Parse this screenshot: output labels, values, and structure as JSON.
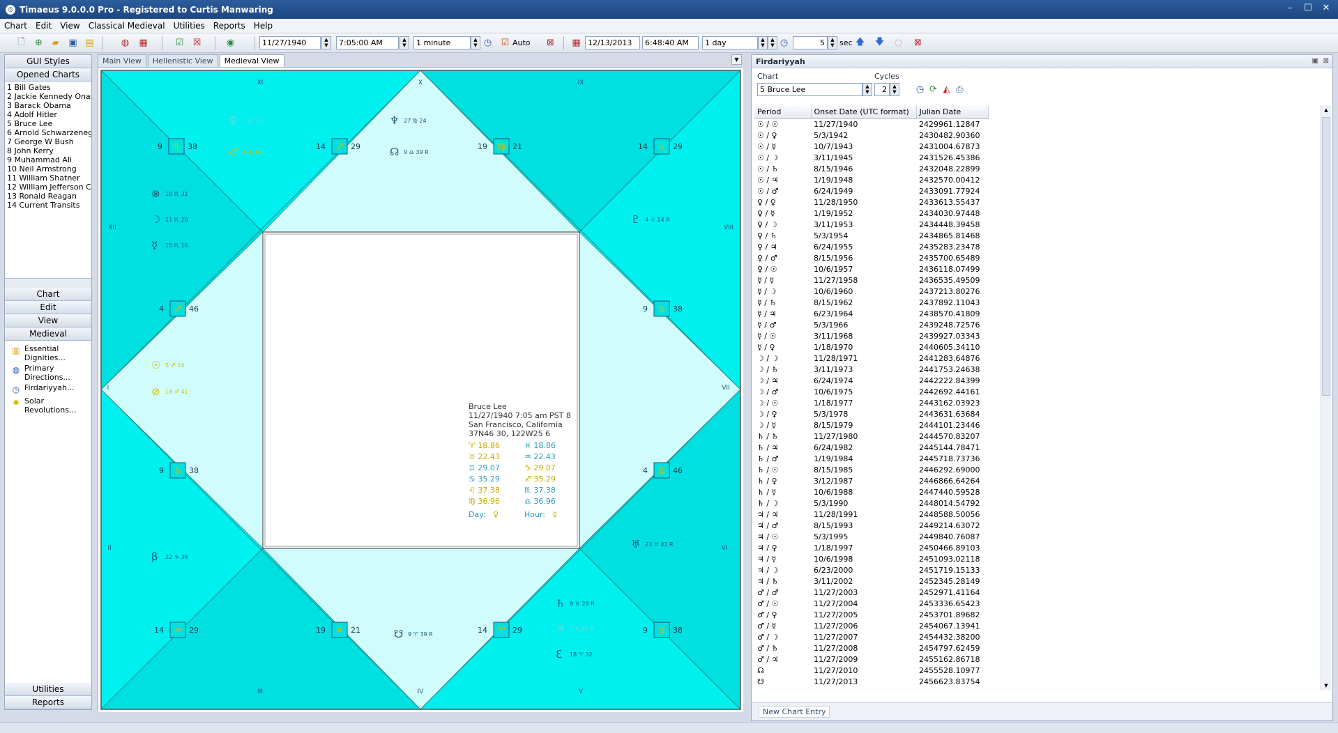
{
  "window": {
    "title": "Timaeus 9.0.0.0 Pro - Registered to Curtis Manwaring",
    "controls": [
      "–",
      "☐",
      "✕"
    ]
  },
  "menu": [
    "Chart",
    "Edit",
    "View",
    "Classical Medieval",
    "Utilities",
    "Reports",
    "Help"
  ],
  "toolbar": {
    "birth_date": "11/27/1940",
    "birth_time": "7:05:00 AM",
    "step1": "1 minute",
    "auto_label": "Auto",
    "transit_date": "12/13/2013",
    "transit_time": "6:48:40 AM",
    "step2": "1 day",
    "seconds": "5",
    "sec_label": "sec"
  },
  "left": {
    "gui_styles": "GUI Styles",
    "opened_charts": "Opened Charts",
    "charts": [
      "1 Bill Gates",
      "2 Jackie Kennedy Onassis",
      "3 Barack Obama",
      "4 Adolf Hitler",
      "5 Bruce Lee",
      "6 Arnold Schwarzenegger",
      "7 George W Bush",
      "8 John Kerry",
      "9 Muhammad Ali",
      "10 Neil Armstrong",
      "11 William Shatner",
      "12 William Jefferson Clinton",
      "13 Ronald Reagan",
      "14 Current Transits"
    ],
    "nav": [
      "Chart",
      "Edit",
      "View",
      "Medieval"
    ],
    "actions": [
      {
        "icon": "essential-dignities-icon",
        "label1": "Essential",
        "label2": "Dignities..."
      },
      {
        "icon": "primary-directions-icon",
        "label1": "Primary",
        "label2": "Directions..."
      },
      {
        "icon": "firdariyyah-icon",
        "label1": "Firdariyyah...",
        "label2": ""
      },
      {
        "icon": "solar-revolutions-icon",
        "label1": "Solar",
        "label2": "Revolutions..."
      }
    ],
    "bottom_nav": [
      "Utilities",
      "Reports"
    ]
  },
  "tabs": [
    "Main View",
    "Hellenistic View",
    "Medieval View"
  ],
  "chart": {
    "colors": {
      "dark": "#00e0e0",
      "mid": "#00f0f0",
      "light": "#d0fcfc",
      "accent": "#2a8b8b"
    },
    "houses": [
      {
        "roman": "XI"
      },
      {
        "roman": "X"
      },
      {
        "roman": "IX"
      },
      {
        "roman": "XII"
      },
      {
        "roman": "VIII"
      },
      {
        "roman": "I"
      },
      {
        "roman": "VII"
      },
      {
        "roman": "II"
      },
      {
        "roman": "VI"
      },
      {
        "roman": "III"
      },
      {
        "roman": "IV"
      },
      {
        "roman": "V"
      }
    ],
    "cusps": [
      {
        "deg": "9",
        "sign": "♏",
        "min": "38"
      },
      {
        "deg": "14",
        "sign": "♐",
        "min": "29"
      },
      {
        "deg": "19",
        "sign": "♍",
        "min": "21"
      },
      {
        "deg": "14",
        "sign": "♌",
        "min": "29"
      },
      {
        "deg": "4",
        "sign": "♐",
        "min": "46"
      },
      {
        "deg": "9",
        "sign": "♋",
        "min": "38"
      },
      {
        "deg": "9",
        "sign": "♑",
        "min": "38"
      },
      {
        "deg": "4",
        "sign": "♊",
        "min": "46"
      },
      {
        "deg": "14",
        "sign": "♒",
        "min": "29"
      },
      {
        "deg": "19",
        "sign": "♓",
        "min": "21"
      },
      {
        "deg": "14",
        "sign": "♈",
        "min": "29"
      },
      {
        "deg": "9",
        "sign": "♉",
        "min": "38"
      }
    ],
    "planets": [
      {
        "glyph": "♀",
        "text": "1 ♏ 11",
        "color": "#7fd0d0"
      },
      {
        "glyph": "♂",
        "text": "6 ♏ 03",
        "color": "#d4c000"
      },
      {
        "glyph": "♆",
        "text": "27 ♍ 24",
        "color": "#1a5a7a"
      },
      {
        "glyph": "☊",
        "text": "9 ♎ 39 R",
        "color": "#1a5a7a"
      },
      {
        "glyph": "♇",
        "text": "4 ♌ 14 R",
        "color": "#1a5a7a"
      },
      {
        "glyph": "⊗",
        "text": "10 ♏ 31",
        "color": "#1a5a7a"
      },
      {
        "glyph": "☽",
        "text": "11 ♏ 20",
        "color": "#1a5a7a"
      },
      {
        "glyph": "☿",
        "text": "15 ♏ 16",
        "color": "#1a5a7a"
      },
      {
        "glyph": "☉",
        "text": "5 ♐ 14",
        "color": "#d4c000"
      },
      {
        "glyph": "⊘",
        "text": "18 ♐ 41",
        "color": "#d4c000"
      },
      {
        "glyph": "β",
        "text": "22 ♑ 36",
        "color": "#1a5a7a"
      },
      {
        "glyph": "☋",
        "text": "9 ♈ 39 R",
        "color": "#1a5a7a"
      },
      {
        "glyph": "♅",
        "text": "23 ♉ 41 R",
        "color": "#1a5a7a"
      },
      {
        "glyph": "♄",
        "text": "9 ♉ 29 R",
        "color": "#1a5a7a"
      },
      {
        "glyph": "♃",
        "text": "7 ♉ 40 R",
        "color": "#7fd0d0"
      },
      {
        "glyph": "ℇ",
        "text": "18 ♈ 32",
        "color": "#1a5a7a"
      }
    ],
    "info": {
      "name": "Bruce Lee",
      "datetime": "11/27/1940  7:05 am  PST 8",
      "place": "San Francisco, California",
      "coords": "37N46 30,  122W25 6",
      "positions": [
        {
          "text": "♈  18.86",
          "color": "#c8a800"
        },
        {
          "text": "♓  18.86",
          "color": "#2a9bbf"
        },
        {
          "text": "♉  22.43",
          "color": "#c8a800"
        },
        {
          "text": "♒  22.43",
          "color": "#2a9bbf"
        },
        {
          "text": "♊  29.07",
          "color": "#2a9bbf"
        },
        {
          "text": "♑  29.07",
          "color": "#c8a800"
        },
        {
          "text": "♋  35.29",
          "color": "#2a9bbf"
        },
        {
          "text": "♐  35.29",
          "color": "#c8a800"
        },
        {
          "text": "♌  37.38",
          "color": "#c8a800"
        },
        {
          "text": "♏  37.38",
          "color": "#2a9bbf"
        },
        {
          "text": "♍  36.96",
          "color": "#c8a800"
        },
        {
          "text": "♎  36.96",
          "color": "#2a9bbf"
        }
      ],
      "day_label": "Day:",
      "day_value": "♀",
      "hour_label": "Hour:",
      "hour_value": "☿"
    }
  },
  "firdariyyah": {
    "title": "Firdariyyah",
    "chart_label": "Chart",
    "chart_value": "5 Bruce Lee",
    "cycles_label": "Cycles",
    "cycles_value": "2",
    "columns": [
      "Period",
      "Onset Date (UTC format)",
      "Julian Date"
    ],
    "rows": [
      [
        "☉ / ☉",
        "11/27/1940",
        "2429961.12847"
      ],
      [
        "☉ / ♀",
        "5/3/1942",
        "2430482.90360"
      ],
      [
        "☉ / ☿",
        "10/7/1943",
        "2431004.67873"
      ],
      [
        "☉ / ☽",
        "3/11/1945",
        "2431526.45386"
      ],
      [
        "☉ / ♄",
        "8/15/1946",
        "2432048.22899"
      ],
      [
        "☉ / ♃",
        "1/19/1948",
        "2432570.00412"
      ],
      [
        "☉ / ♂",
        "6/24/1949",
        "2433091.77924"
      ],
      [
        "♀ / ♀",
        "11/28/1950",
        "2433613.55437"
      ],
      [
        "♀ / ☿",
        "1/19/1952",
        "2434030.97448"
      ],
      [
        "♀ / ☽",
        "3/11/1953",
        "2434448.39458"
      ],
      [
        "♀ / ♄",
        "5/3/1954",
        "2434865.81468"
      ],
      [
        "♀ / ♃",
        "6/24/1955",
        "2435283.23478"
      ],
      [
        "♀ / ♂",
        "8/15/1956",
        "2435700.65489"
      ],
      [
        "♀ / ☉",
        "10/6/1957",
        "2436118.07499"
      ],
      [
        "☿ / ☿",
        "11/27/1958",
        "2436535.49509"
      ],
      [
        "☿ / ☽",
        "10/6/1960",
        "2437213.80276"
      ],
      [
        "☿ / ♄",
        "8/15/1962",
        "2437892.11043"
      ],
      [
        "☿ / ♃",
        "6/23/1964",
        "2438570.41809"
      ],
      [
        "☿ / ♂",
        "5/3/1966",
        "2439248.72576"
      ],
      [
        "☿ / ☉",
        "3/11/1968",
        "2439927.03343"
      ],
      [
        "☿ / ♀",
        "1/18/1970",
        "2440605.34110"
      ],
      [
        "☽ / ☽",
        "11/28/1971",
        "2441283.64876"
      ],
      [
        "☽ / ♄",
        "3/11/1973",
        "2441753.24638"
      ],
      [
        "☽ / ♃",
        "6/24/1974",
        "2442222.84399"
      ],
      [
        "☽ / ♂",
        "10/6/1975",
        "2442692.44161"
      ],
      [
        "☽ / ☉",
        "1/18/1977",
        "2443162.03923"
      ],
      [
        "☽ / ♀",
        "5/3/1978",
        "2443631.63684"
      ],
      [
        "☽ / ☿",
        "8/15/1979",
        "2444101.23446"
      ],
      [
        "♄ / ♄",
        "11/27/1980",
        "2444570.83207"
      ],
      [
        "♄ / ♃",
        "6/24/1982",
        "2445144.78471"
      ],
      [
        "♄ / ♂",
        "1/19/1984",
        "2445718.73736"
      ],
      [
        "♄ / ☉",
        "8/15/1985",
        "2446292.69000"
      ],
      [
        "♄ / ♀",
        "3/12/1987",
        "2446866.64264"
      ],
      [
        "♄ / ☿",
        "10/6/1988",
        "2447440.59528"
      ],
      [
        "♄ / ☽",
        "5/3/1990",
        "2448014.54792"
      ],
      [
        "♃ / ♃",
        "11/28/1991",
        "2448588.50056"
      ],
      [
        "♃ / ♂",
        "8/15/1993",
        "2449214.63072"
      ],
      [
        "♃ / ☉",
        "5/3/1995",
        "2449840.76087"
      ],
      [
        "♃ / ♀",
        "1/18/1997",
        "2450466.89103"
      ],
      [
        "♃ / ☿",
        "10/6/1998",
        "2451093.02118"
      ],
      [
        "♃ / ☽",
        "6/23/2000",
        "2451719.15133"
      ],
      [
        "♃ / ♄",
        "3/11/2002",
        "2452345.28149"
      ],
      [
        "♂ / ♂",
        "11/27/2003",
        "2452971.41164"
      ],
      [
        "♂ / ☉",
        "11/27/2004",
        "2453336.65423"
      ],
      [
        "♂ / ♀",
        "11/27/2005",
        "2453701.89682"
      ],
      [
        "♂ / ☿",
        "11/27/2006",
        "2454067.13941"
      ],
      [
        "♂ / ☽",
        "11/27/2007",
        "2454432.38200"
      ],
      [
        "♂ / ♄",
        "11/27/2008",
        "2454797.62459"
      ],
      [
        "♂ / ♃",
        "11/27/2009",
        "2455162.86718"
      ],
      [
        "☊",
        "11/27/2010",
        "2455528.10977"
      ],
      [
        "☋",
        "11/27/2013",
        "2456623.83754"
      ]
    ],
    "new_entry": "New Chart Entry"
  }
}
